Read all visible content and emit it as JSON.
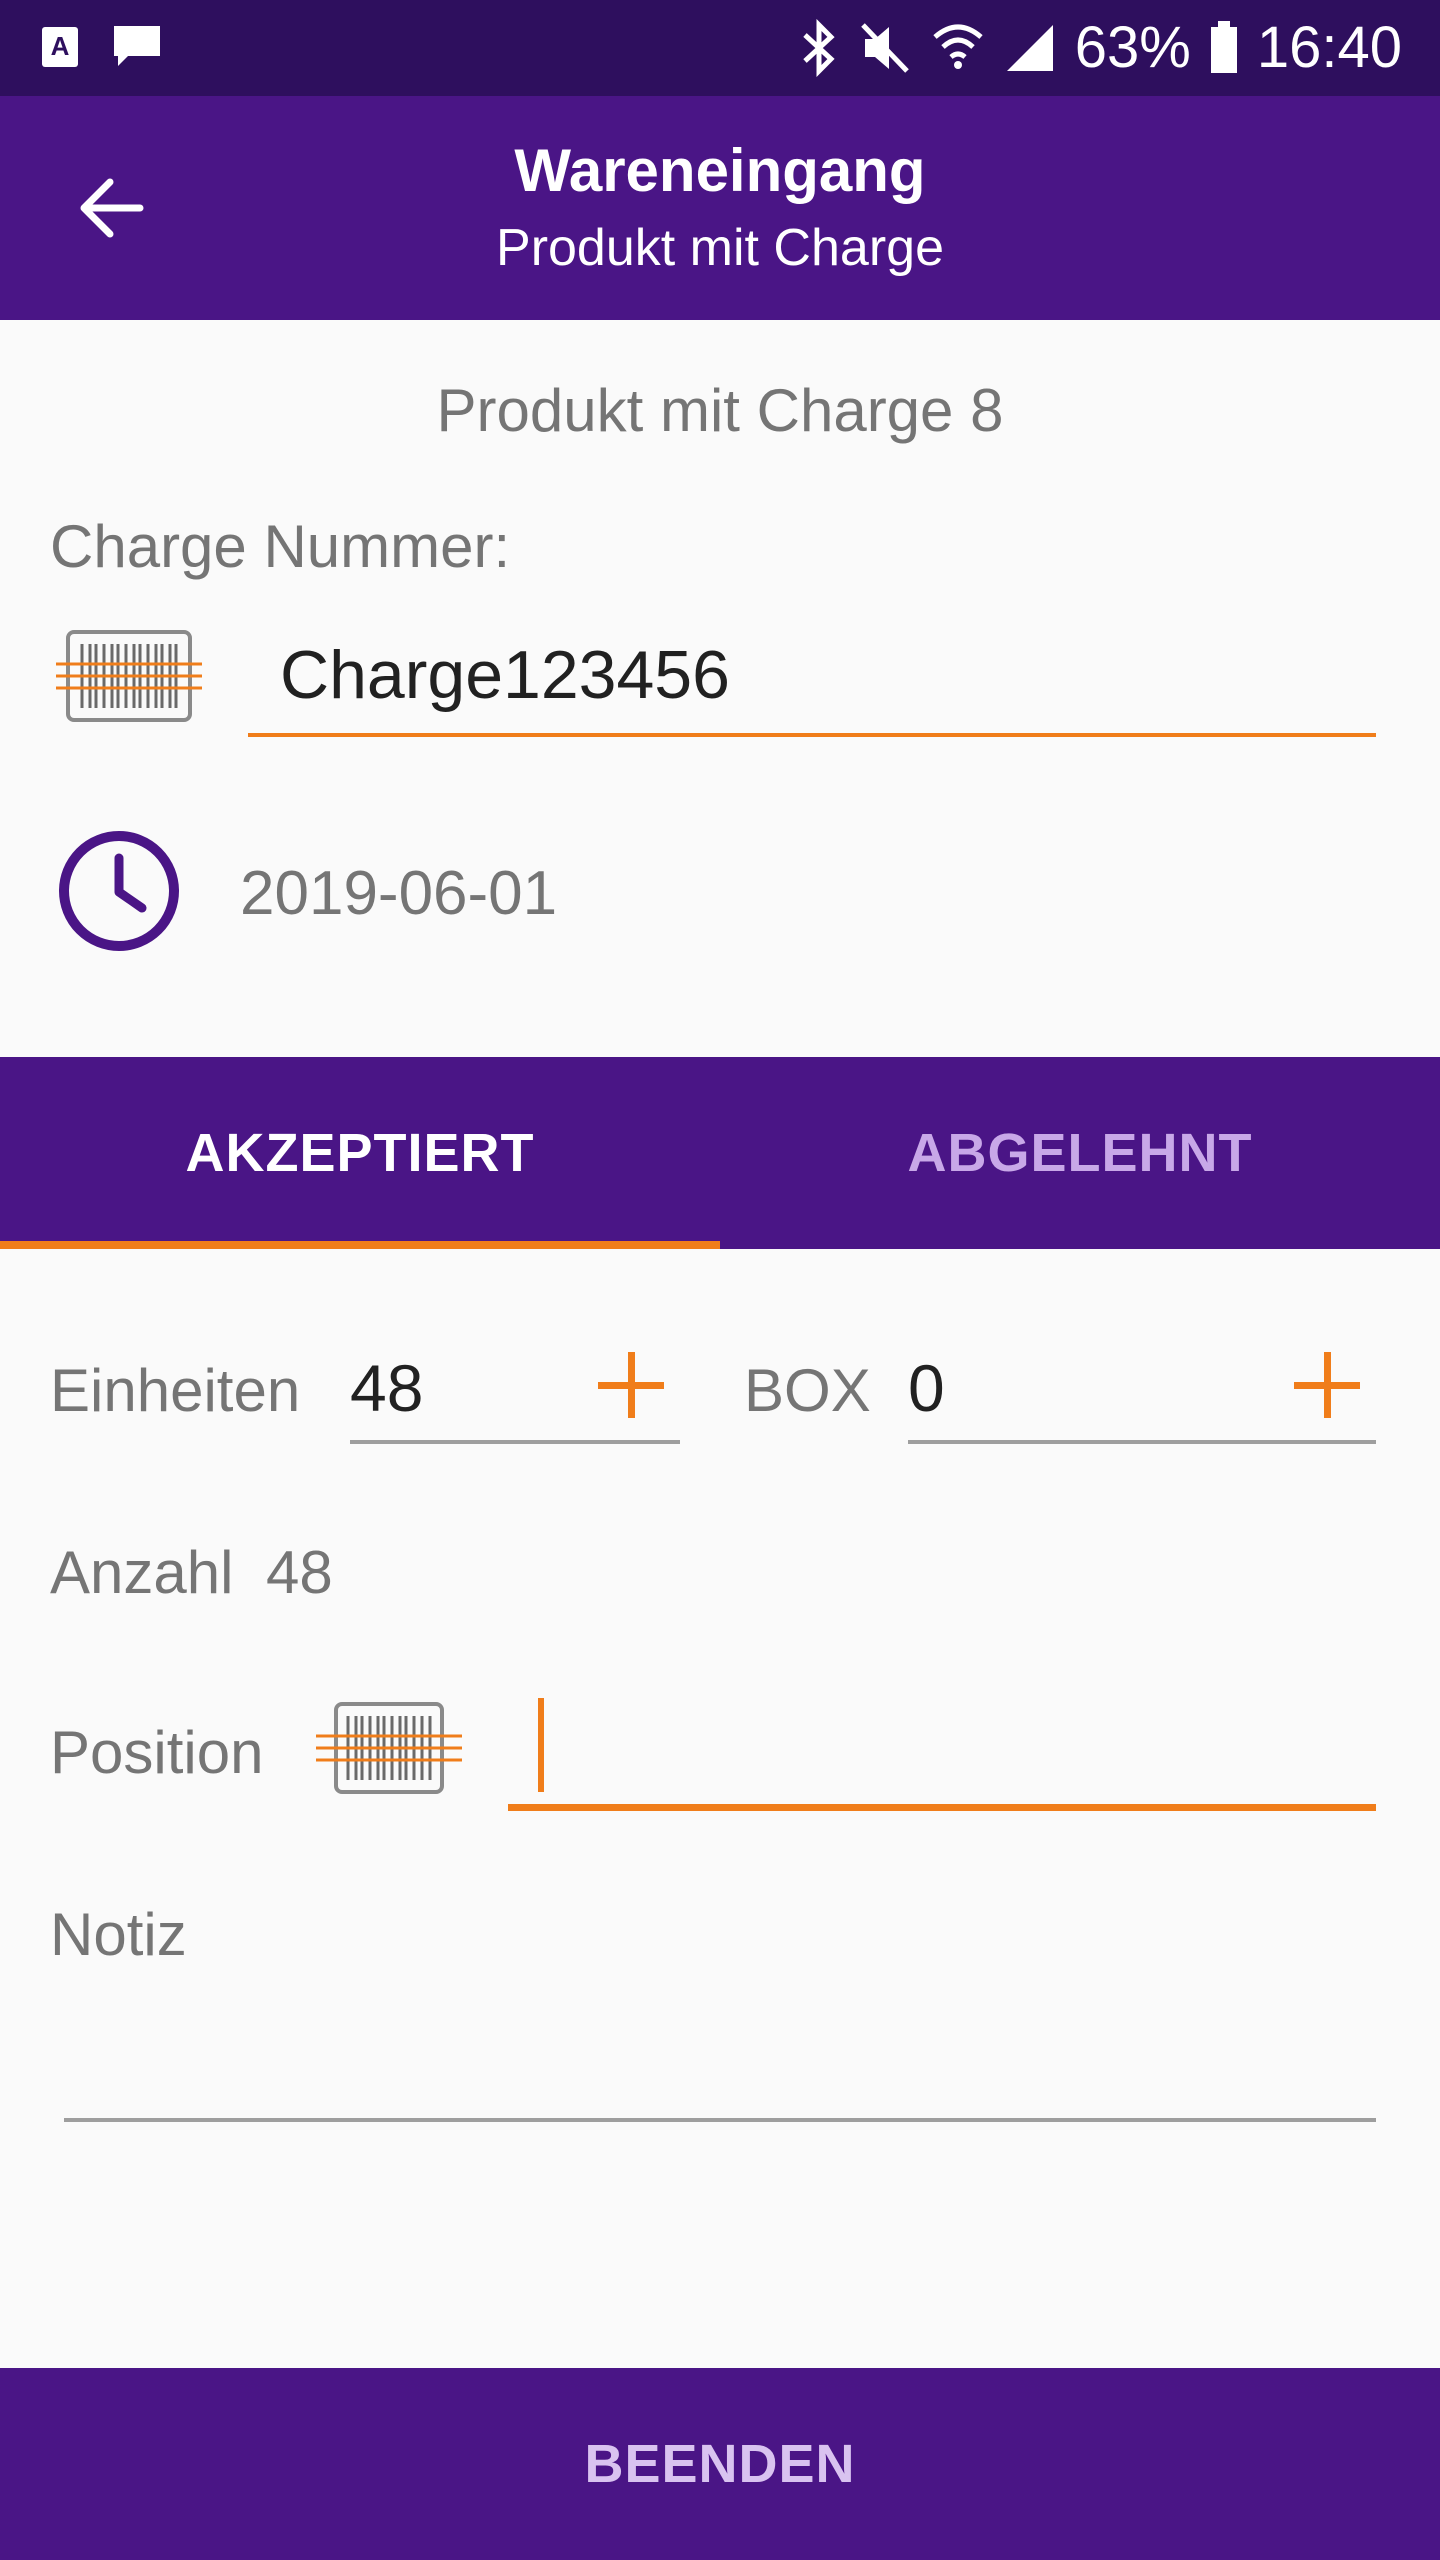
{
  "status_bar": {
    "battery": "63%",
    "time": "16:40",
    "icons": [
      "app-a-icon",
      "message-icon",
      "bluetooth-icon",
      "mute-icon",
      "wifi-icon",
      "signal-icon",
      "battery-icon"
    ]
  },
  "header": {
    "title": "Wareneingang",
    "subtitle": "Produkt mit Charge",
    "back_icon": "arrow-left-icon"
  },
  "product": {
    "name": "Produkt mit Charge 8"
  },
  "charge": {
    "label": "Charge Nummer:",
    "value": "Charge123456",
    "scan_icon": "barcode-scanner-icon"
  },
  "expiry": {
    "icon": "clock-icon",
    "date": "2019-06-01"
  },
  "tabs": [
    {
      "label": "AKZEPTIERT",
      "active": true
    },
    {
      "label": "ABGELEHNT",
      "active": false
    }
  ],
  "quantities": {
    "units_label": "Einheiten",
    "units_value": "48",
    "box_label": "BOX",
    "box_value": "0",
    "count_label": "Anzahl",
    "count_value": "48"
  },
  "position": {
    "label": "Position",
    "value": ""
  },
  "note": {
    "label": "Notiz",
    "value": ""
  },
  "footer": {
    "finish_label": "BEENDEN"
  },
  "colors": {
    "primary": "#4a1586",
    "status_bar": "#2e0f5e",
    "accent": "#f07d1a",
    "text_secondary": "#757575"
  }
}
